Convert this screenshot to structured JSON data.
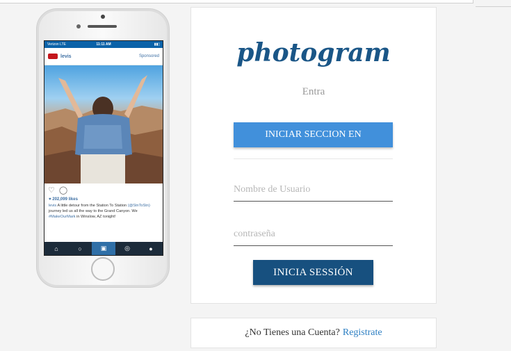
{
  "phone": {
    "status": {
      "carrier": "Verizon LTE",
      "time": "11:11 AM",
      "battery": "▮▮▯"
    },
    "post": {
      "brand": "levis",
      "sponsored": "Sponsored",
      "likes": "♥ 202,099 likes",
      "caption_user": "levis",
      "caption_text": "A little detour from the Station To Station",
      "caption_link1": "(@StnToStn)",
      "caption_text2": "journey led us all the way to the Grand Canyon. We",
      "caption_link2": "#MakeOurMark",
      "caption_text3": "in Winslow, AZ tonight!"
    },
    "tabs": [
      "home-icon",
      "search-icon",
      "camera-icon",
      "activity-icon",
      "profile-icon"
    ]
  },
  "login": {
    "logo": "photogram",
    "subtitle": "Entra",
    "social_button": "INICIAR SECCION EN",
    "username_placeholder": "Nombre de Usuario",
    "password_placeholder": "contraseña",
    "submit_button": "INICIA SESSIÓN"
  },
  "signup": {
    "prompt": "¿No Tienes una Cuenta?",
    "link": "Registrate"
  },
  "colors": {
    "brand": "#1a5687",
    "social_button": "#4190db",
    "submit_button": "#17507f",
    "link": "#2f80c3"
  }
}
